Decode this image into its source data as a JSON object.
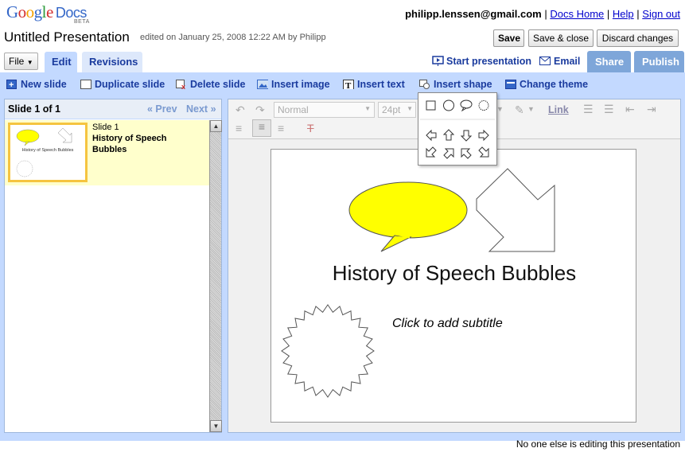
{
  "app": {
    "logo_google": "Google",
    "logo_docs": "Docs",
    "beta": "BETA"
  },
  "header": {
    "email": "philipp.lenssen@gmail.com",
    "sep": "|",
    "docs_home": "Docs Home",
    "help": "Help",
    "sign_out": "Sign out"
  },
  "document": {
    "title": "Untitled Presentation",
    "edited": "edited on January 25, 2008 12:22 AM by Philipp",
    "save": "Save",
    "save_close": "Save & close",
    "discard": "Discard changes"
  },
  "tabs": {
    "file": "File",
    "edit": "Edit",
    "revisions": "Revisions"
  },
  "actions": {
    "start": "Start presentation",
    "email": "Email",
    "share": "Share",
    "publish": "Publish"
  },
  "toolbar": {
    "new_slide": "New slide",
    "duplicate_slide": "Duplicate slide",
    "delete_slide": "Delete slide",
    "insert_image": "Insert image",
    "insert_text": "Insert text",
    "insert_shape": "Insert shape",
    "change_theme": "Change theme"
  },
  "slides_panel": {
    "count": "Slide 1 of 1",
    "prev": "« Prev",
    "next": "Next »",
    "slide_label": "Slide 1",
    "slide_title": "History of Speech Bubbles"
  },
  "format": {
    "style": "Normal",
    "size": "24pt",
    "link": "Link",
    "clear": "T"
  },
  "slide": {
    "title": "History of Speech Bubbles",
    "subtitle": "Click to add subtitle",
    "bubble_color": "#ffff00"
  },
  "status": "No one else is editing this presentation"
}
